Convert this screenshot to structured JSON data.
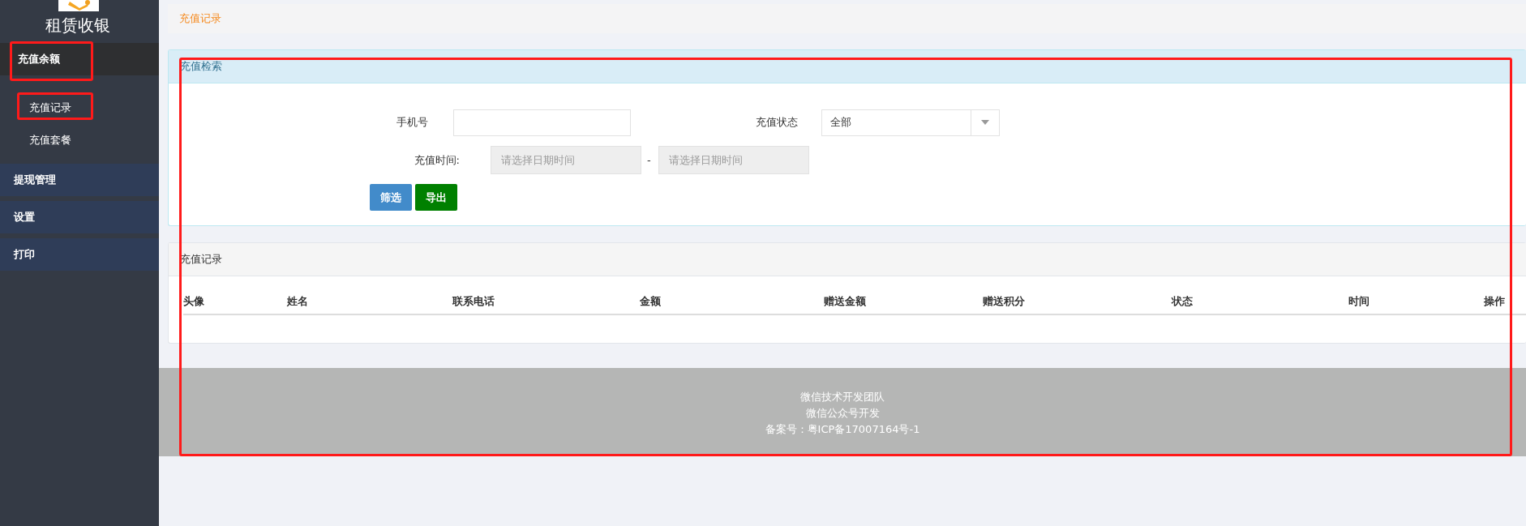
{
  "sidebar": {
    "title": "租赁收银",
    "groups": [
      {
        "label": "充值余额",
        "expanded": true,
        "children": [
          {
            "label": "充值记录"
          },
          {
            "label": "充值套餐"
          }
        ]
      },
      {
        "label": "提现管理",
        "expanded": false
      },
      {
        "label": "设置",
        "expanded": false
      },
      {
        "label": "打印",
        "expanded": false
      }
    ]
  },
  "breadcrumb": "充值记录",
  "search_panel": {
    "title": "充值检索",
    "phone": {
      "label": "手机号"
    },
    "status": {
      "label": "充值状态",
      "value": "全部"
    },
    "time": {
      "label": "充值时间:",
      "start_placeholder": "请选择日期时间",
      "separator": "-",
      "end_placeholder": "请选择日期时间"
    },
    "buttons": [
      {
        "label": "筛选",
        "kind": "primary"
      },
      {
        "label": "导出",
        "kind": "success"
      }
    ]
  },
  "records_panel": {
    "title": "充值记录",
    "columns": [
      "头像",
      "姓名",
      "联系电话",
      "金额",
      "赠送金额",
      "赠送积分",
      "状态",
      "时间",
      "操作"
    ]
  },
  "footer": [
    "微信技术开发团队",
    "微信公众号开发",
    "备案号：粤ICP备17007164号-1"
  ]
}
